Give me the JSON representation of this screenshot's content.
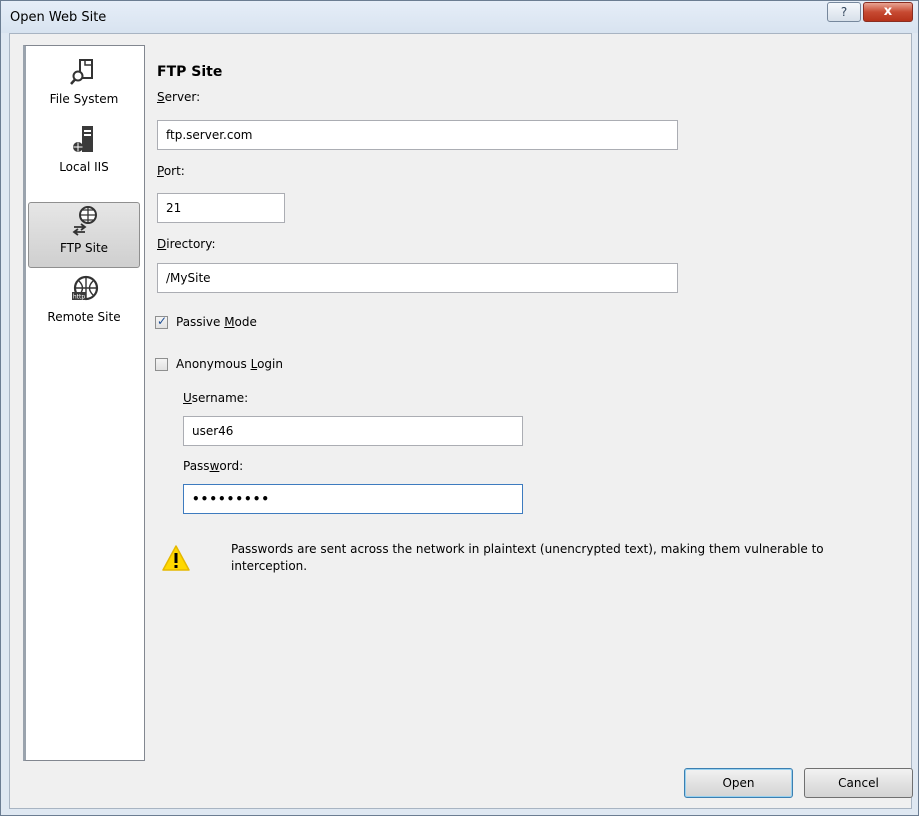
{
  "window": {
    "title": "Open Web Site",
    "help_label": "?",
    "close_label": "x"
  },
  "sidebar": {
    "items": [
      {
        "label": "File System",
        "icon": "file-system-icon"
      },
      {
        "label": "Local IIS",
        "icon": "local-iis-server-icon"
      },
      {
        "label": "FTP Site",
        "icon": "ftp-site-icon",
        "selected": true
      },
      {
        "label": "Remote Site",
        "icon": "remote-site-icon"
      }
    ]
  },
  "form": {
    "section_title": "FTP Site",
    "server": {
      "label_pre": "",
      "label_ul": "S",
      "label_post": "erver:",
      "value": "ftp.server.com"
    },
    "port": {
      "label_pre": "",
      "label_ul": "P",
      "label_post": "ort:",
      "value": "21"
    },
    "directory": {
      "label_pre": "",
      "label_ul": "D",
      "label_post": "irectory:",
      "value": "/MySite"
    },
    "passive": {
      "label_pre": "Passive ",
      "label_ul": "M",
      "label_post": "ode",
      "checked": true
    },
    "anonymous": {
      "label_pre": "Anonymous ",
      "label_ul": "L",
      "label_post": "ogin",
      "checked": false
    },
    "username": {
      "label_pre": "",
      "label_ul": "U",
      "label_post": "sername:",
      "value": "user46"
    },
    "password": {
      "label_pre": "Pass",
      "label_ul": "w",
      "label_post": "ord:",
      "value": "•••••••••"
    }
  },
  "warning": {
    "icon": "warning-icon",
    "text": "Passwords are sent across the network in plaintext (unencrypted text), making them vulnerable to interception."
  },
  "buttons": {
    "open": "Open",
    "cancel": "Cancel"
  }
}
